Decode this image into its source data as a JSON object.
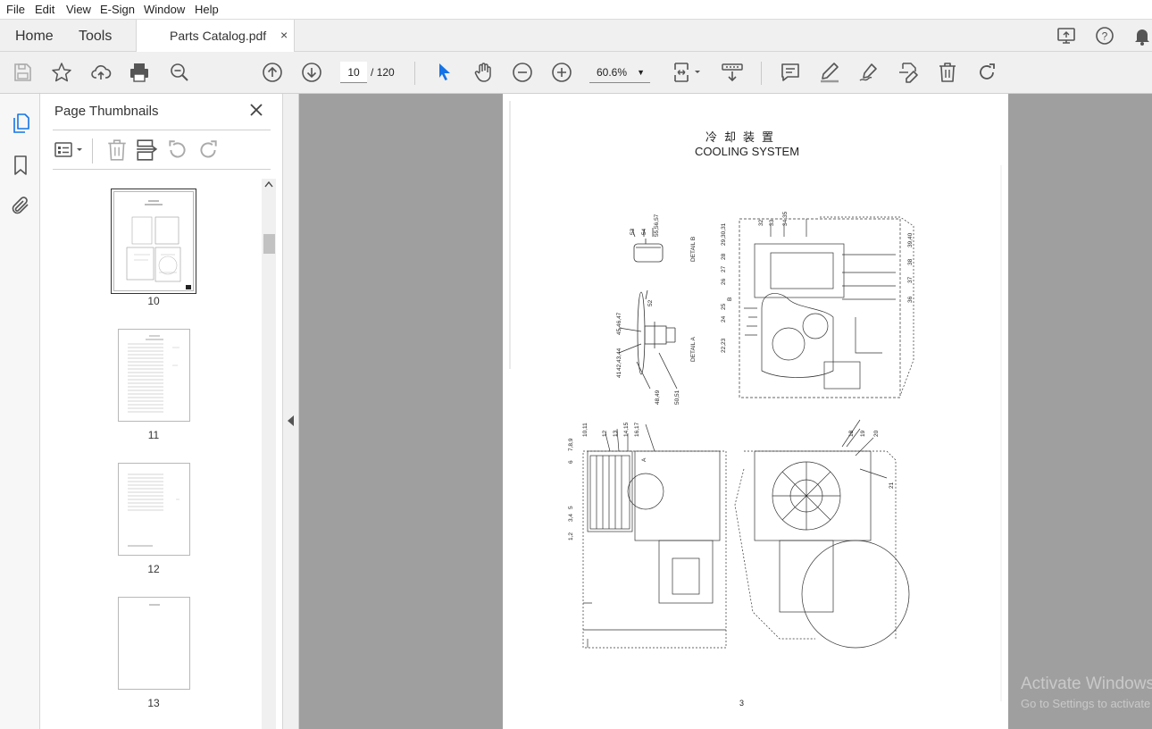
{
  "menu": [
    "File",
    "Edit",
    "View",
    "E-Sign",
    "Window",
    "Help"
  ],
  "tabs": {
    "home": "Home",
    "tools": "Tools",
    "document_title": "Parts Catalog.pdf",
    "close_glyph": "×"
  },
  "toolbar": {
    "current_page": "10",
    "page_separator": "/",
    "total_pages": "120",
    "zoom": "60.6%"
  },
  "thumbnails": {
    "title": "Page Thumbnails",
    "pages": [
      "10",
      "11",
      "12",
      "13"
    ],
    "selected": "10"
  },
  "document": {
    "title_jp": "冷却装置",
    "title_en": "COOLING SYSTEM",
    "page_number": "3",
    "detail_labels": [
      "DETAIL B",
      "DETAIL A"
    ],
    "callouts": [
      "53",
      "54",
      "55,56,57",
      "52",
      "45,46,47",
      "42,43,44",
      "41",
      "48,49",
      "50,51",
      "32",
      "33",
      "34,35",
      "29,30,31",
      "28",
      "27",
      "26",
      "25",
      "24",
      "22,23",
      "39,40",
      "38",
      "37",
      "36",
      "B",
      "A",
      "10,11",
      "12",
      "13",
      "14,15",
      "16,17",
      "7,8,9",
      "6",
      "5",
      "3,4",
      "1,2",
      "18",
      "19",
      "20",
      "21"
    ]
  },
  "watermark": {
    "line1": "Activate Windows",
    "line2": "Go to Settings to activate Windows."
  },
  "colors": {
    "accent": "#1473e6",
    "viewer_bg": "#9f9f9f",
    "chrome": "#f0f0f0"
  }
}
